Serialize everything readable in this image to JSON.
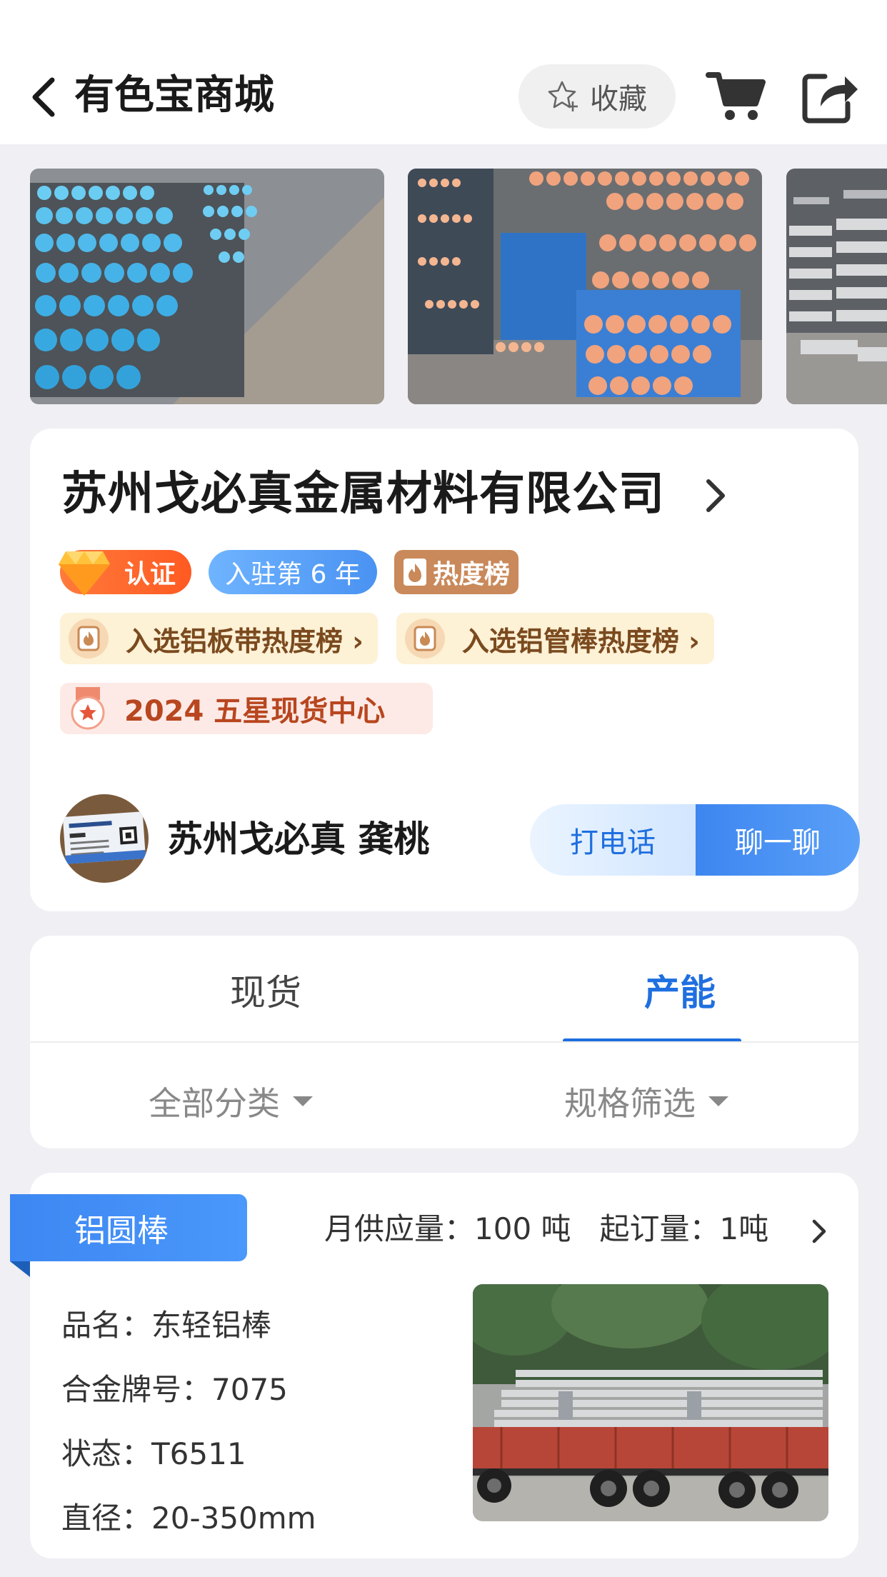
{
  "header": {
    "title": "有色宝商城",
    "favorite_label": "收藏"
  },
  "gallery": {
    "photos": [
      "aluminum-bars-blue-caps-photo",
      "aluminum-bars-orange-caps-photo",
      "aluminum-plates-photo"
    ]
  },
  "company": {
    "name": "苏州戈必真金属材料有限公司",
    "cert_badge": "认证",
    "years_badge": "入驻第 6 年",
    "hot_badge": "热度榜",
    "rank_tags": [
      "入选铝板带热度榜 ›",
      "入选铝管棒热度榜 ›"
    ],
    "star_tag": "2024 五星现货中心",
    "contact_name": "苏州戈必真 龚桃",
    "call_label": "打电话",
    "chat_label": "聊一聊"
  },
  "tabs": {
    "items": [
      "现货",
      "产能"
    ],
    "active": "产能",
    "filters": [
      "全部分类",
      "规格筛选"
    ]
  },
  "product": {
    "category": "铝圆棒",
    "monthly_supply": "月供应量：100 吨",
    "min_order": "起订量：1吨",
    "specs": [
      "品名：东轻铝棒",
      "合金牌号：7075",
      "状态：T6511",
      "直径：20-350mm"
    ]
  },
  "colors": {
    "accent_blue": "#1f6fe0",
    "cert_orange": "#ff5a22",
    "hot_brown": "#c9895a",
    "star_red": "#b8461f"
  }
}
